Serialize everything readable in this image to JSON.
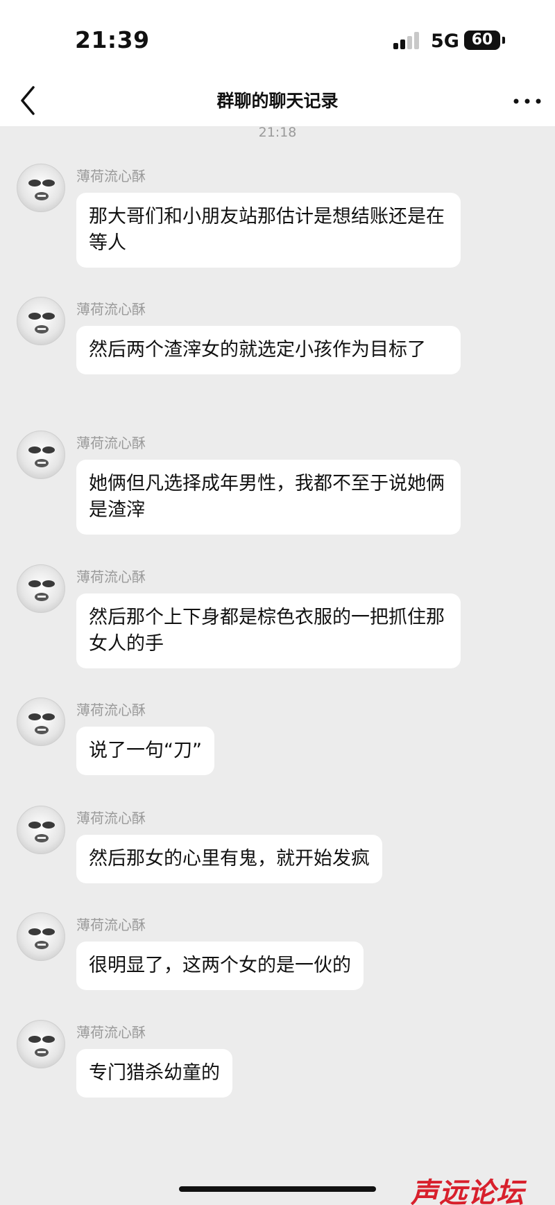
{
  "status_bar": {
    "time": "21:39",
    "network": "5G",
    "battery": "60"
  },
  "nav": {
    "title": "群聊的聊天记录",
    "back_icon": "chevron-left-icon",
    "more_icon": "ellipsis-icon"
  },
  "chat": {
    "timestamp": "21:18",
    "messages": [
      {
        "sender": "薄荷流心酥",
        "text": "那大哥们和小朋友站那估计是想结账还是在等人"
      },
      {
        "sender": "薄荷流心酥",
        "text": "然后两个渣滓女的就选定小孩作为目标了"
      },
      {
        "sender": "薄荷流心酥",
        "text": "她俩但凡选择成年男性，我都不至于说她俩是渣滓"
      },
      {
        "sender": "薄荷流心酥",
        "text": "然后那个上下身都是棕色衣服的一把抓住那女人的手"
      },
      {
        "sender": "薄荷流心酥",
        "text": "说了一句“刀”"
      },
      {
        "sender": "薄荷流心酥",
        "text": "然后那女的心里有鬼，就开始发疯"
      },
      {
        "sender": "薄荷流心酥",
        "text": "很明显了，这两个女的是一伙的"
      },
      {
        "sender": "薄荷流心酥",
        "text": "专门猎杀幼童的"
      }
    ]
  },
  "watermark": "声远论坛",
  "colors": {
    "background": "#ececec",
    "bubble": "#ffffff",
    "text": "#111111",
    "meta": "#9a9a9a",
    "watermark": "#d8202c"
  }
}
